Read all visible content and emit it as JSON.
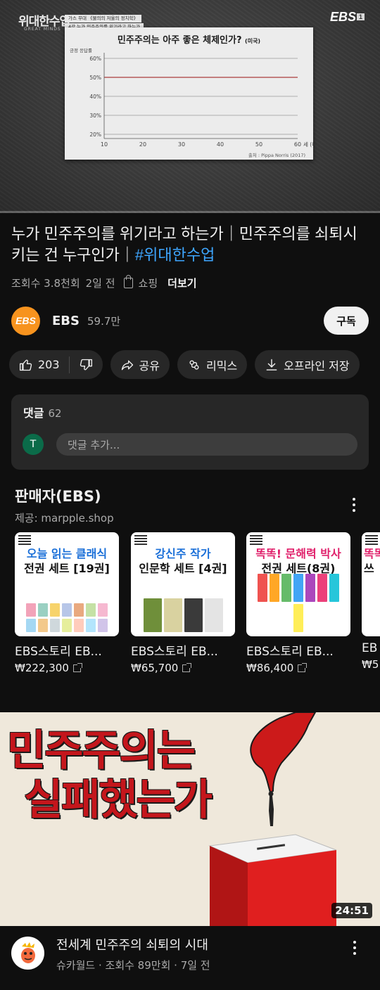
{
  "player": {
    "show_logo": "위대한수업",
    "show_sub": "GREAT MINDS",
    "episode_lines": [
      "가스 무대 《불의의 저울의 정치학》",
      "4강 누가 민주주의를 위기라고 하는가"
    ],
    "channel_mark": "EBS",
    "channel_mark_badge": "1",
    "chart_data": {
      "type": "line",
      "title": "민주주의는 아주 좋은 체제인가?",
      "title_suffix": "(미국)",
      "ylabel": "긍정 응답률",
      "y_ticks": [
        "60%",
        "50%",
        "40%",
        "30%",
        "20%"
      ],
      "x_ticks": [
        "10",
        "20",
        "30",
        "40",
        "50",
        "60"
      ],
      "xlabel": "세 (나이)",
      "ylim": [
        20,
        60
      ],
      "xlim": [
        10,
        60
      ],
      "grid": true,
      "highlight_line_value": 50,
      "highlight_color": "#b55a5a",
      "source": "출처 : Pippa Norris (2017)"
    },
    "progress_fraction": 0.0
  },
  "video": {
    "title_main": "누가 민주주의를 위기라고 하는가｜민주주의를 쇠퇴시키는 건 누구인가｜",
    "title_hashtag": "#위대한수업",
    "views": "조회수 3.8천회",
    "age": "2일 전",
    "shopping": "쇼핑",
    "more": "더보기"
  },
  "channel": {
    "avatar_text": "EBS",
    "avatar_color": "#f7931e",
    "name": "EBS",
    "subscribers": "59.7만",
    "subscribe_label": "구독"
  },
  "actions": {
    "likes": "203",
    "share": "공유",
    "remix": "리믹스",
    "download": "오프라인 저장"
  },
  "comments": {
    "label": "댓글",
    "count": "62",
    "user_initial": "T",
    "placeholder": "댓글 추가..."
  },
  "seller": {
    "title": "판매자(EBS)",
    "provider": "제공: marpple.shop",
    "products": [
      {
        "headline_a": "오늘 읽는 클래식",
        "headline_b": "전권 세트 [19권]",
        "name": "EBS스토리 EB...",
        "price": "₩222,300"
      },
      {
        "headline_a": "강신주 작가",
        "headline_b": "인문학 세트 [4권]",
        "name": "EBS스토리 EB...",
        "price": "₩65,700"
      },
      {
        "headline_a": "똑똑! 문해력 박사",
        "headline_b": "전권 세트(8권)",
        "name": "EBS스토리 EB...",
        "price": "₩86,400"
      },
      {
        "headline_a": "똑똑",
        "headline_b": "쓰",
        "name": "EB",
        "price": "₩5"
      }
    ]
  },
  "next_video": {
    "thumb_line1": "민주주의는",
    "thumb_line2": "실패했는가",
    "duration": "24:51",
    "title": "전세계 민주주의 쇠퇴의 시대",
    "channel": "슈카월드",
    "views": "조회수 89만회",
    "age": "7일 전"
  }
}
